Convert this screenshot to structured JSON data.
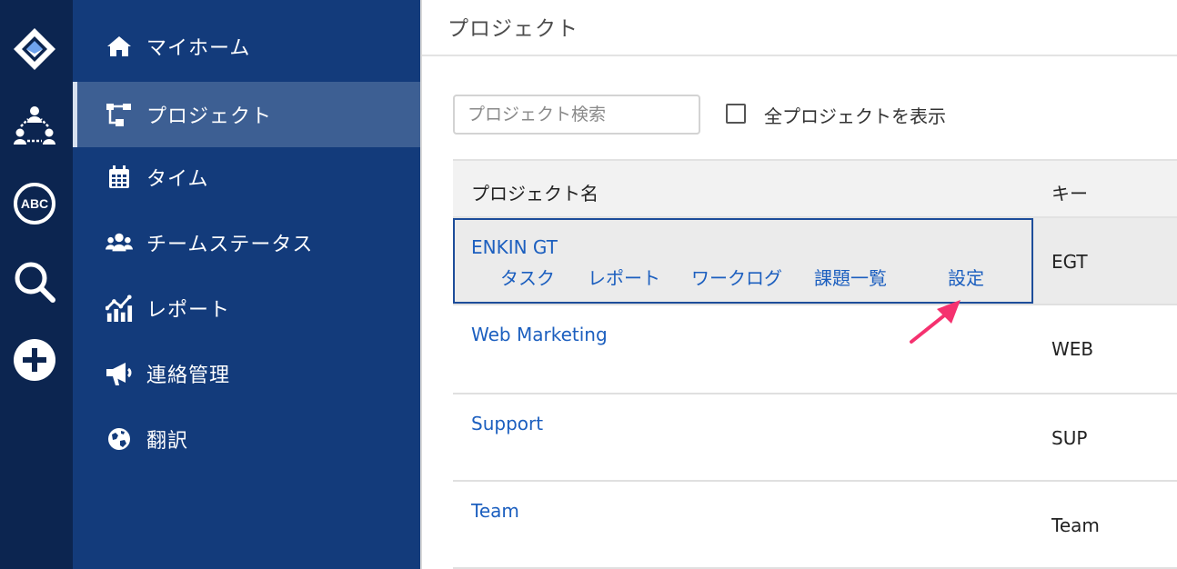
{
  "rail": {
    "icons": [
      "app-logo-icon",
      "team-network-icon",
      "spellcheck-abc-icon",
      "search-icon",
      "add-circle-icon"
    ],
    "abc_text": "ABC"
  },
  "sidebar": {
    "items": [
      {
        "label": "マイホーム",
        "icon": "home-icon"
      },
      {
        "label": "プロジェクト",
        "icon": "project-tree-icon",
        "active": true
      },
      {
        "label": "タイム",
        "icon": "calendar-icon"
      },
      {
        "label": "チームステータス",
        "icon": "users-icon"
      },
      {
        "label": "レポート",
        "icon": "chart-icon"
      },
      {
        "label": "連絡管理",
        "icon": "megaphone-icon"
      },
      {
        "label": "翻訳",
        "icon": "globe-icon"
      }
    ]
  },
  "main": {
    "title": "プロジェクト",
    "search": {
      "placeholder": "プロジェクト検索",
      "value": ""
    },
    "show_all_label": "全プロジェクトを表示",
    "columns": [
      "プロジェクト名",
      "キー"
    ],
    "rows": [
      {
        "name": "ENKIN GT",
        "key": "EGT",
        "links": [
          "タスク",
          "レポート",
          "ワークログ",
          "課題一覧",
          "設定"
        ]
      },
      {
        "name": "Web Marketing",
        "key": "WEB"
      },
      {
        "name": "Support",
        "key": "SUP"
      },
      {
        "name": "Team",
        "key": "Team"
      }
    ]
  },
  "colors": {
    "rail_bg": "#0c2550",
    "sidebar_bg": "#133b7b",
    "sidebar_active": "#3d5f93",
    "link": "#1c5fbf",
    "annotation_arrow": "#f5316f"
  }
}
